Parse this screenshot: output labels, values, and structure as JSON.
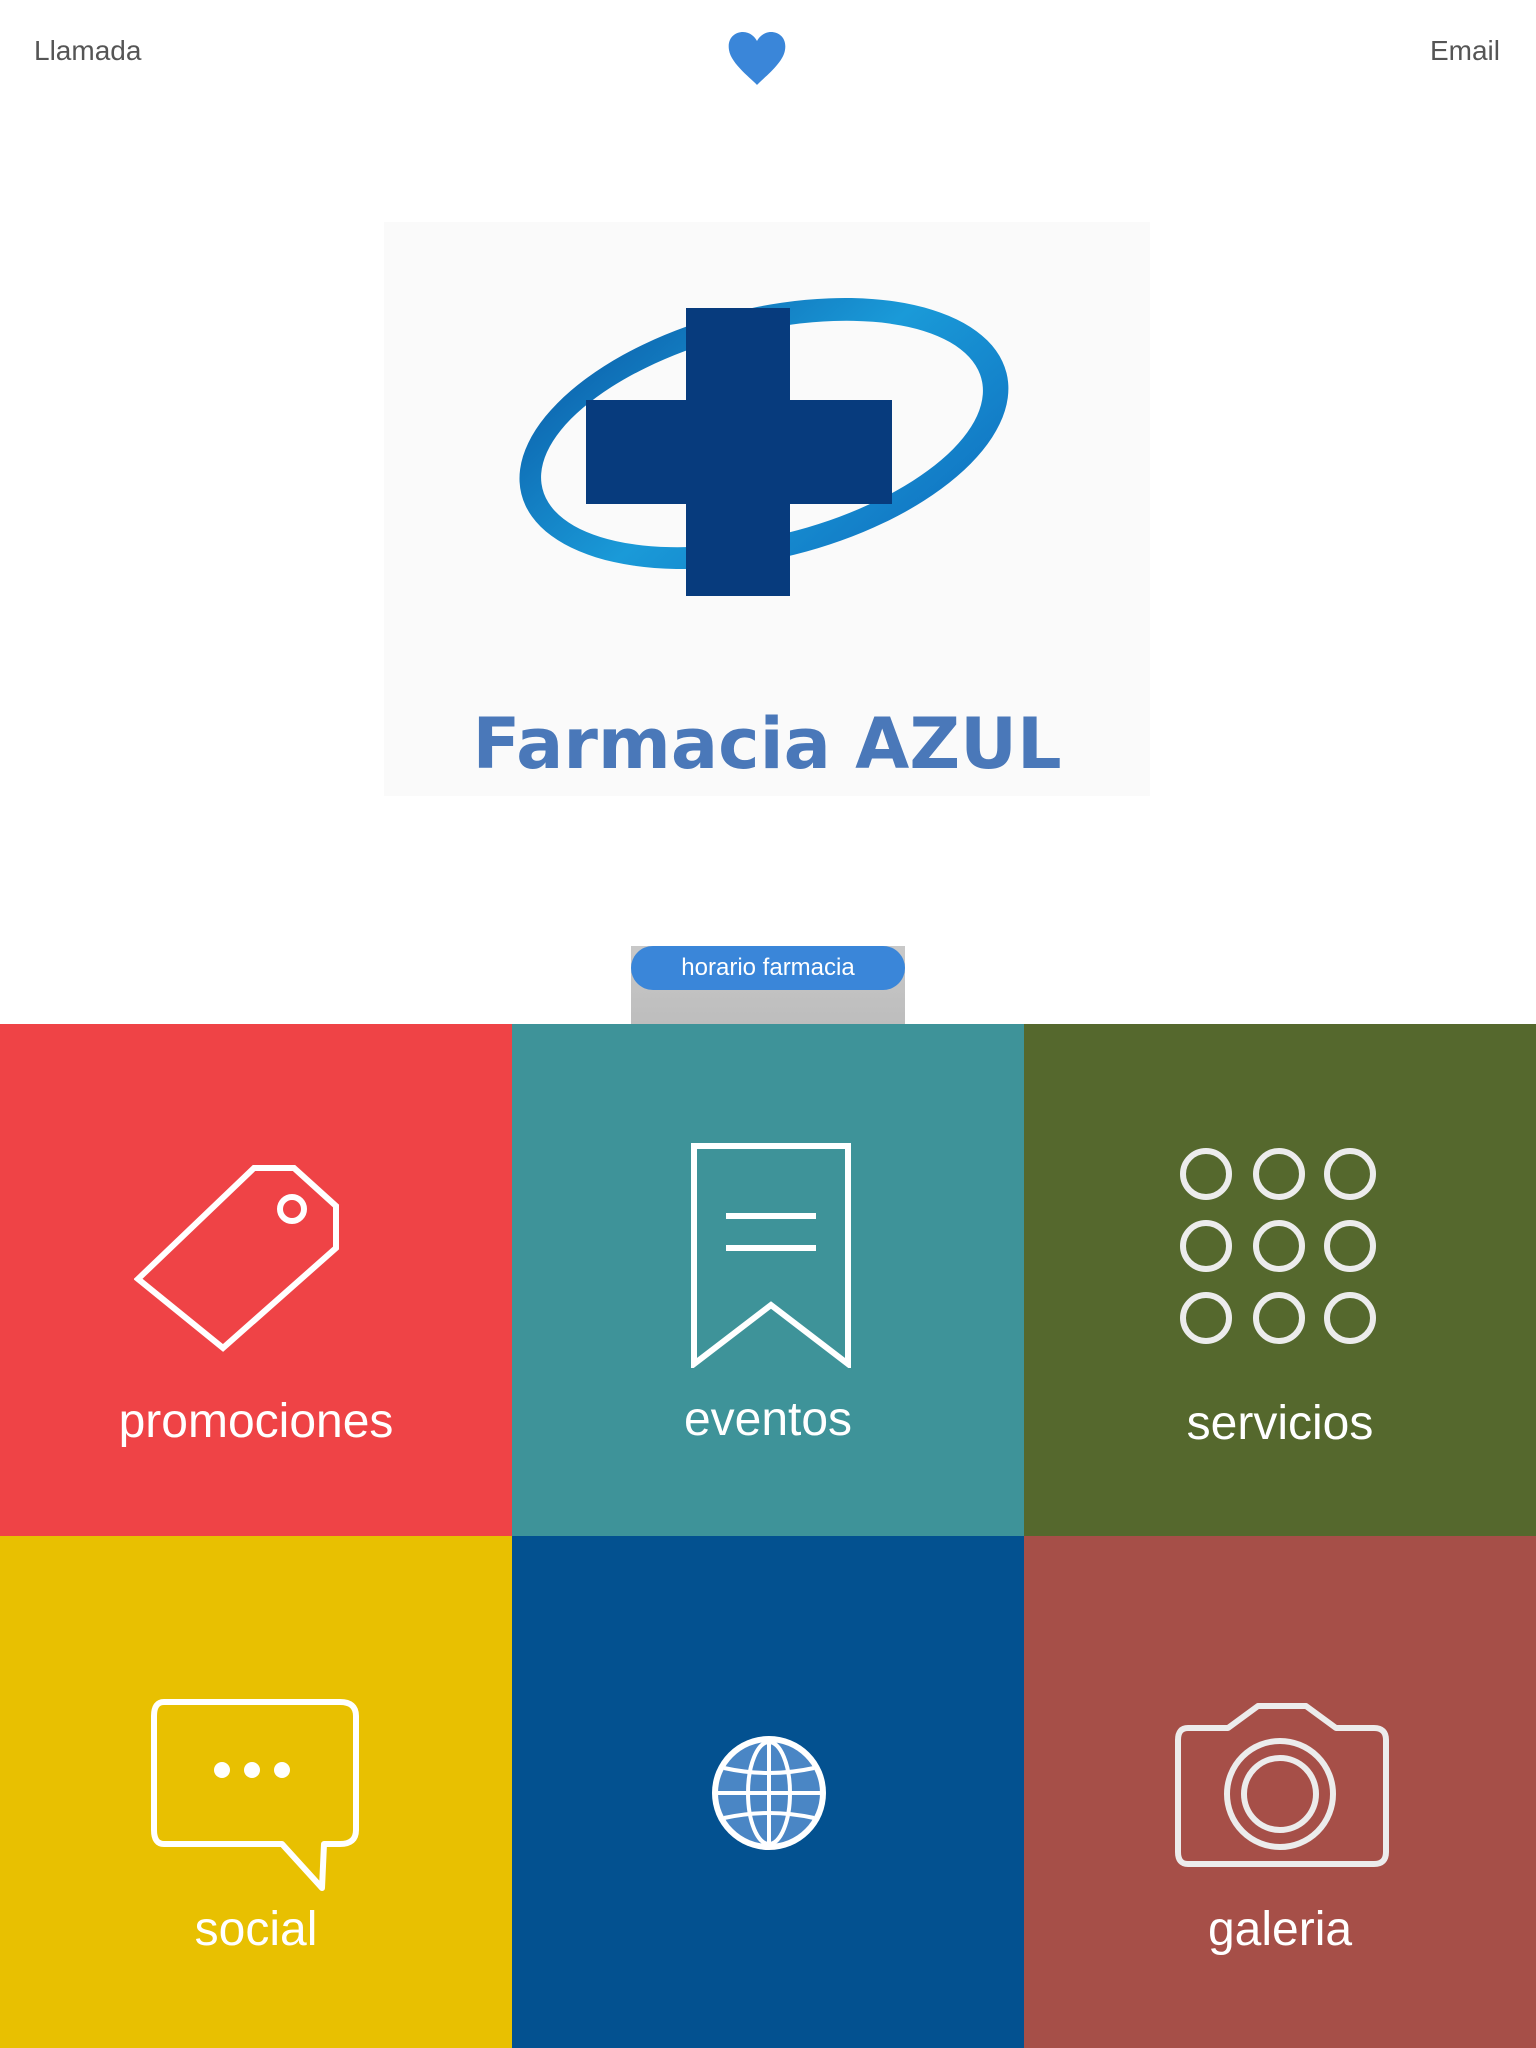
{
  "header": {
    "call_label": "Llamada",
    "email_label": "Email",
    "heart_color": "#3a86d9"
  },
  "logo": {
    "text": "Farmacia AZUL",
    "icon": "cross-emblem-icon",
    "text_color": "#4a78b9",
    "cross_color": "#073b7d",
    "ring_color": "#1a9ad8"
  },
  "hours_tab": {
    "label": "horario farmacia",
    "color": "#3a86d9"
  },
  "tiles": [
    {
      "label": "promociones",
      "icon": "tag-icon",
      "color": "#ef4346"
    },
    {
      "label": "eventos",
      "icon": "bookmark-icon",
      "color": "#3e9399"
    },
    {
      "label": "servicios",
      "icon": "grid-dots-icon",
      "color": "#55682d"
    },
    {
      "label": "social",
      "icon": "chat-bubble-icon",
      "color": "#e8c001"
    },
    {
      "label": "",
      "icon": "globe-icon",
      "color": "#035190"
    },
    {
      "label": "galeria",
      "icon": "camera-icon",
      "color": "#a64f48"
    }
  ]
}
